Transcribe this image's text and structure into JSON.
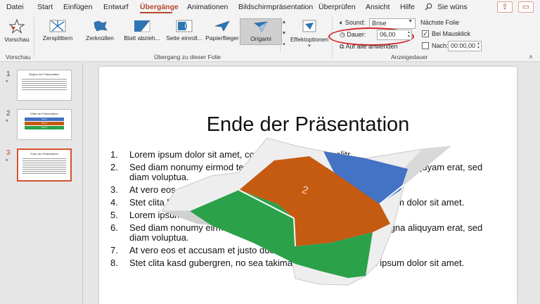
{
  "menu": {
    "tabs": [
      "Datei",
      "Start",
      "Einfügen",
      "Entwurf",
      "Übergänge",
      "Animationen",
      "Bildschirmpräsentation",
      "Überprüfen",
      "Ansicht",
      "Hilfe"
    ],
    "active_tab": "Übergänge",
    "search_label": "Sie wüns",
    "accent_color": "#b7472a"
  },
  "ribbon": {
    "preview": {
      "label": "Vorschau",
      "group_label": "Vorschau"
    },
    "transitions": {
      "items": [
        "Zersplittern",
        "Zerknüllen",
        "Blatt abzieh...",
        "Seite einroll...",
        "Papierflieger",
        "Origami"
      ],
      "selected": "Origami",
      "effect_options_label": "Effektoptionen",
      "group_label": "Übergang zu dieser Folie"
    },
    "timing": {
      "sound_label": "Sound:",
      "sound_value": "Brise",
      "duration_label": "Dauer:",
      "duration_value": "06,00",
      "apply_all_label": "Auf alle anwenden",
      "next_slide_label": "Nächste Folie",
      "on_click_label": "Bei Mausklick",
      "on_click_checked": true,
      "after_label": "Nach:",
      "after_checked": false,
      "after_value": "00:00,00",
      "group_label": "Anzeigedauer"
    }
  },
  "thumbnails": [
    {
      "number": "1",
      "star": "*",
      "title": "Beginn der Präsentation"
    },
    {
      "number": "2",
      "star": "*",
      "title": "Mitte der Präsentation",
      "bars": [
        "Text 1",
        "Text 2",
        "Text 3"
      ]
    },
    {
      "number": "3",
      "star": "*",
      "title": "Ende der Präsentation"
    }
  ],
  "slide": {
    "title": "Ende der Präsentation",
    "items": [
      {
        "n": "1.",
        "text": "Lorem ipsum dolor sit amet, consetetur sadipscing elitr."
      },
      {
        "n": "2.",
        "text": "Sed diam nonumy eirmod tempor invidunt ut labore et dolore magna aliquyam erat, sed diam voluptua."
      },
      {
        "n": "3.",
        "text": "At vero eos et accusam et justo duo dolores et ea rebum."
      },
      {
        "n": "4.",
        "text": "Stet clita kasd gubergren, no sea takimata sanctus est Lorem ipsum dolor sit amet."
      },
      {
        "n": "5.",
        "text": "Lorem ipsum dolor sit amet, consetetur sadipscing elitr."
      },
      {
        "n": "6.",
        "text": "Sed diam nonumy eirmod tempor invidunt ut labore et dolore magna aliquyam erat, sed diam voluptua."
      },
      {
        "n": "7.",
        "text": "At vero eos et accusam et justo duo dolores et ea rebum."
      },
      {
        "n": "8.",
        "text": "Stet clita kasd gubergren, no sea takimata sanctus est Lorem ipsum dolor sit amet."
      }
    ],
    "fold_label": "2"
  },
  "colors": {
    "bar_blue": "#4472c4",
    "bar_orange": "#c55a11",
    "bar_green": "#2ba14a",
    "highlight_red": "#d4252a"
  }
}
